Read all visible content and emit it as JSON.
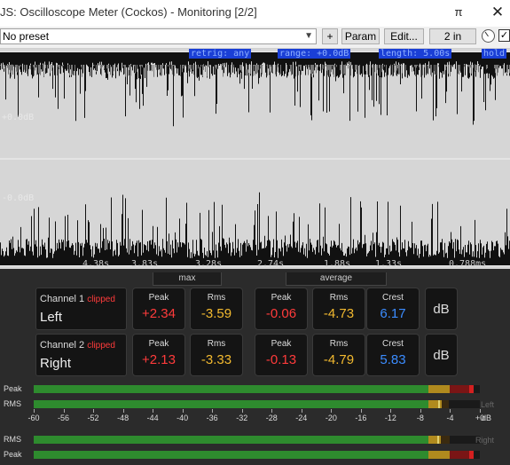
{
  "window": {
    "title": "JS: Oscilloscope Meter (Cockos) - Monitoring [2/2]",
    "pin_symbol": "π",
    "close_symbol": "✕"
  },
  "toolbar": {
    "preset": "No preset",
    "plus": "+",
    "param": "Param",
    "edit": "Edit...",
    "io": "2 in",
    "check": "✓"
  },
  "scope": {
    "hud": {
      "retrig": "retrig: any",
      "range": "range: +0.0dB",
      "length": "length: 5.00s",
      "hold": "hold"
    },
    "db_labels": [
      "+0.0dB",
      "-0.0dB"
    ],
    "time_labels": [
      "4.38s",
      "3.83s",
      "3.28s",
      "2.74s",
      "1.88s",
      "1.33s",
      "0.788ms"
    ]
  },
  "meters": {
    "max_label": "max",
    "average_label": "average",
    "channels": [
      {
        "title": "Channel 1",
        "clipped": "clipped",
        "name": "Left",
        "max_peak": {
          "label": "Peak",
          "value": "+2.34"
        },
        "max_rms": {
          "label": "Rms",
          "value": "-3.59"
        },
        "avg_peak": {
          "label": "Peak",
          "value": "-0.06"
        },
        "avg_rms": {
          "label": "Rms",
          "value": "-4.73"
        },
        "crest": {
          "label": "Crest",
          "value": "6.17"
        },
        "unit": "dB"
      },
      {
        "title": "Channel 2",
        "clipped": "clipped",
        "name": "Right",
        "max_peak": {
          "label": "Peak",
          "value": "+2.13"
        },
        "max_rms": {
          "label": "Rms",
          "value": "-3.33"
        },
        "avg_peak": {
          "label": "Peak",
          "value": "-0.13"
        },
        "avg_rms": {
          "label": "Rms",
          "value": "-4.79"
        },
        "crest": {
          "label": "Crest",
          "value": "5.83"
        },
        "unit": "dB"
      }
    ],
    "bars": {
      "top_peak": "Peak",
      "top_rms": "RMS",
      "left_tag": "Left",
      "bottom_rms": "RMS",
      "bottom_peak": "Peak",
      "right_tag": "Right",
      "scale_labels": [
        "-60",
        "-56",
        "-52",
        "-48",
        "-44",
        "-40",
        "-36",
        "-32",
        "-28",
        "-24",
        "-20",
        "-16",
        "-12",
        "-8",
        "-4",
        "+0"
      ],
      "scale_unit": "dB"
    },
    "colors": {
      "red": "#ff3b3b",
      "yellow": "#f2b92f",
      "blue": "#3b8cff"
    }
  }
}
